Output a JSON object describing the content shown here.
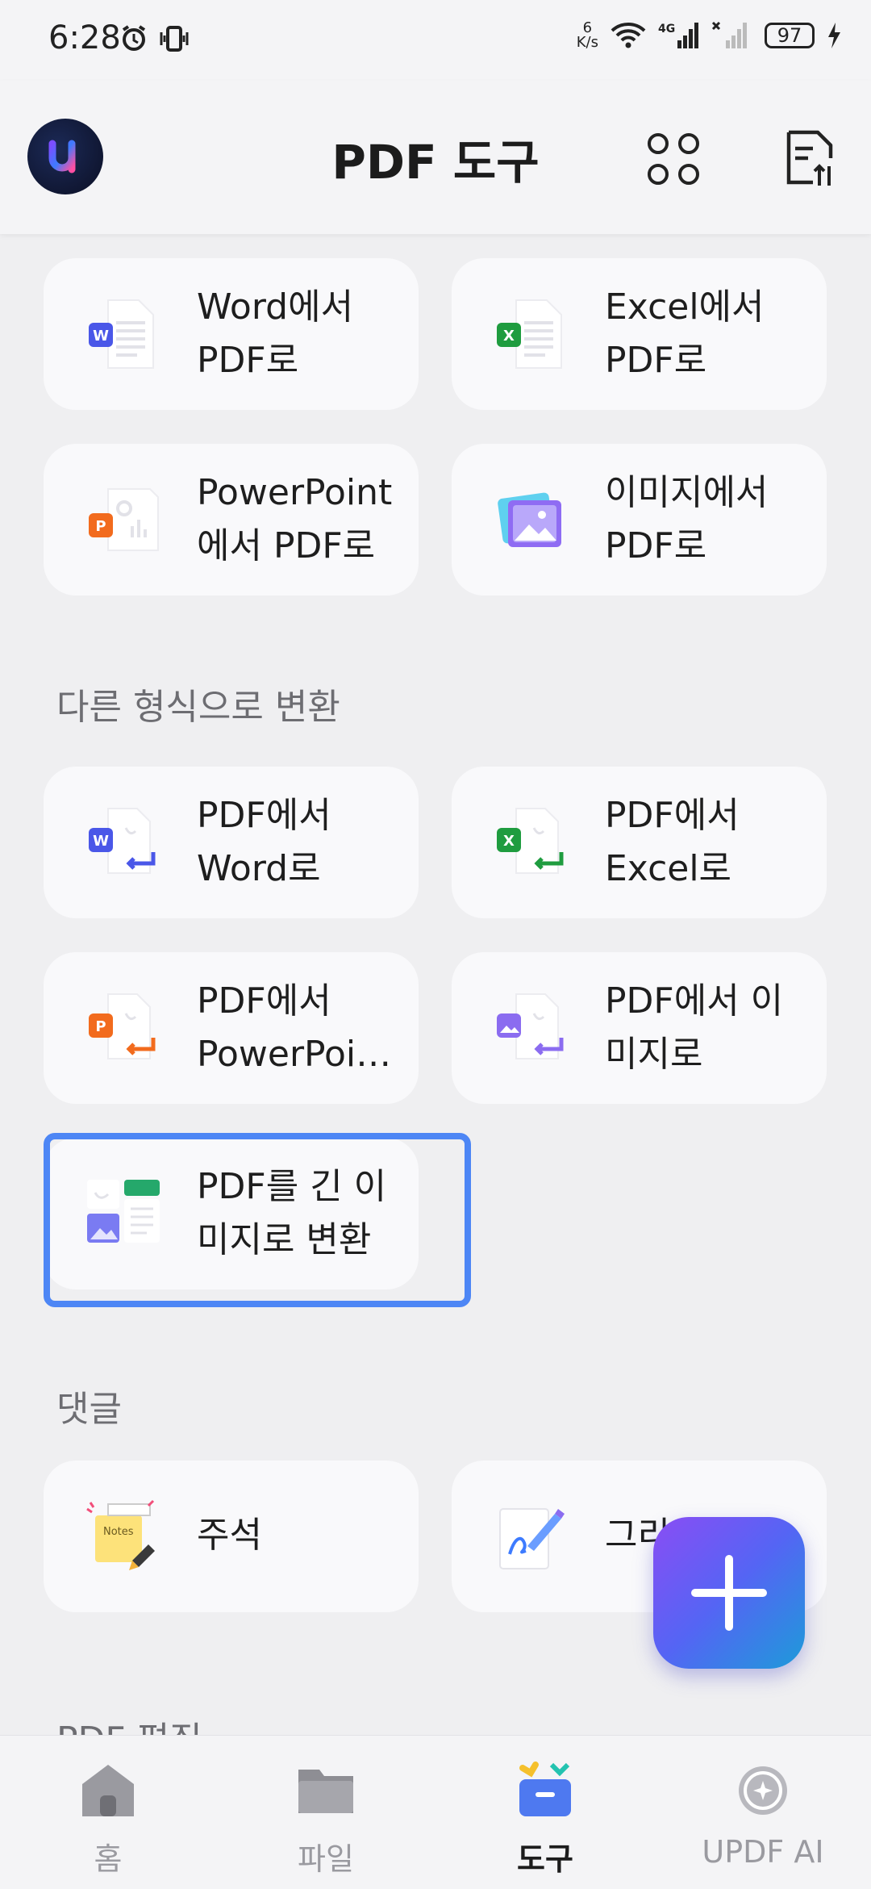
{
  "status": {
    "time": "6:28",
    "net_speed_value": "6",
    "net_speed_unit": "K/s",
    "network": "4G",
    "battery": "97"
  },
  "header": {
    "title": "PDF 도구"
  },
  "cards_top": [
    {
      "label": "Word에서\nPDF로",
      "icon": "word-to-pdf-icon"
    },
    {
      "label": "Excel에서\nPDF로",
      "icon": "excel-to-pdf-icon"
    },
    {
      "label": "PowerPoint\n에서 PDF로",
      "icon": "ppt-to-pdf-icon"
    },
    {
      "label": "이미지에서\nPDF로",
      "icon": "image-to-pdf-icon"
    }
  ],
  "sections": {
    "convert": "다른 형식으로 변환",
    "comment": "댓글",
    "edit": "PDF 편집"
  },
  "cards_convert": [
    {
      "label": "PDF에서\nWord로",
      "icon": "pdf-to-word-icon"
    },
    {
      "label": "PDF에서\nExcel로",
      "icon": "pdf-to-excel-icon"
    },
    {
      "label": "PDF에서\nPowerPoi…",
      "icon": "pdf-to-ppt-icon"
    },
    {
      "label": "PDF에서 이\n미지로",
      "icon": "pdf-to-image-icon"
    },
    {
      "label": "PDF를 긴 이\n미지로 변환",
      "icon": "pdf-to-long-image-icon"
    }
  ],
  "cards_comment": [
    {
      "label": "주석",
      "icon": "notes-icon"
    },
    {
      "label": "그리",
      "icon": "draw-icon"
    }
  ],
  "bottom_nav": [
    {
      "label": "홈",
      "icon": "home-icon"
    },
    {
      "label": "파일",
      "icon": "folder-icon"
    },
    {
      "label": "도구",
      "icon": "tools-icon",
      "active": true
    },
    {
      "label": "UPDF AI",
      "icon": "ai-icon"
    }
  ],
  "colors": {
    "accent": "#4d86f5",
    "word": "#4a57e8",
    "excel": "#1f9c3f",
    "ppt": "#f26b1d",
    "image": "#8b6cf0"
  }
}
